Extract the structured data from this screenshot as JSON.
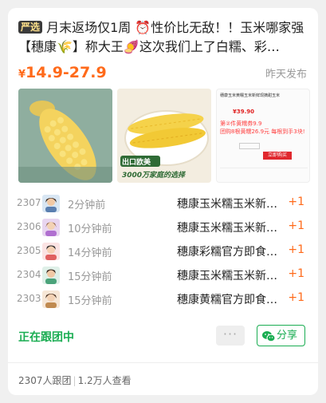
{
  "post": {
    "badge": "严选",
    "title": "月末返场仅1周 ⏰性价比无敌！！玉米哪家强【穗康🌾】称大王🍠这次我们上了白糯、彩…",
    "price_currency": "¥",
    "price_range": "14.9-27.9",
    "publish_time": "昨天发布"
  },
  "images": {
    "img2_caption_top": "出口欧美",
    "img2_caption_bottom": "3000万家庭的选择",
    "img3_header": "穗康玉米黄糯玉米新鲜现摘甜玉米",
    "img3_price": "¥39.90",
    "img3_promo1": "第②件黄糯券9.9",
    "img3_promo2": "团购8根黄糯26.9元 每根到手3块!",
    "img3_buy": "立即购买"
  },
  "followers": [
    {
      "rank": "2307",
      "ago": "2分钟前",
      "product": "穗康玉米糯玉米新…",
      "count": "+1"
    },
    {
      "rank": "2306",
      "ago": "10分钟前",
      "product": "穗康玉米糯玉米新…",
      "count": "+1"
    },
    {
      "rank": "2305",
      "ago": "14分钟前",
      "product": "穗康彩糯官方即食…",
      "count": "+1"
    },
    {
      "rank": "2304",
      "ago": "15分钟前",
      "product": "穗康玉米糯玉米新…",
      "count": "+1"
    },
    {
      "rank": "2303",
      "ago": "15分钟前",
      "product": "穗康黄糯官方即食…",
      "count": "+1"
    }
  ],
  "actions": {
    "following_label": "正在跟团中",
    "more_label": "···",
    "share_label": "分享"
  },
  "stats": {
    "joined": "2307人跟团",
    "views": "1.2万人查看"
  },
  "colors": {
    "accent_orange": "#ff6a1a",
    "accent_green": "#1aad52"
  }
}
